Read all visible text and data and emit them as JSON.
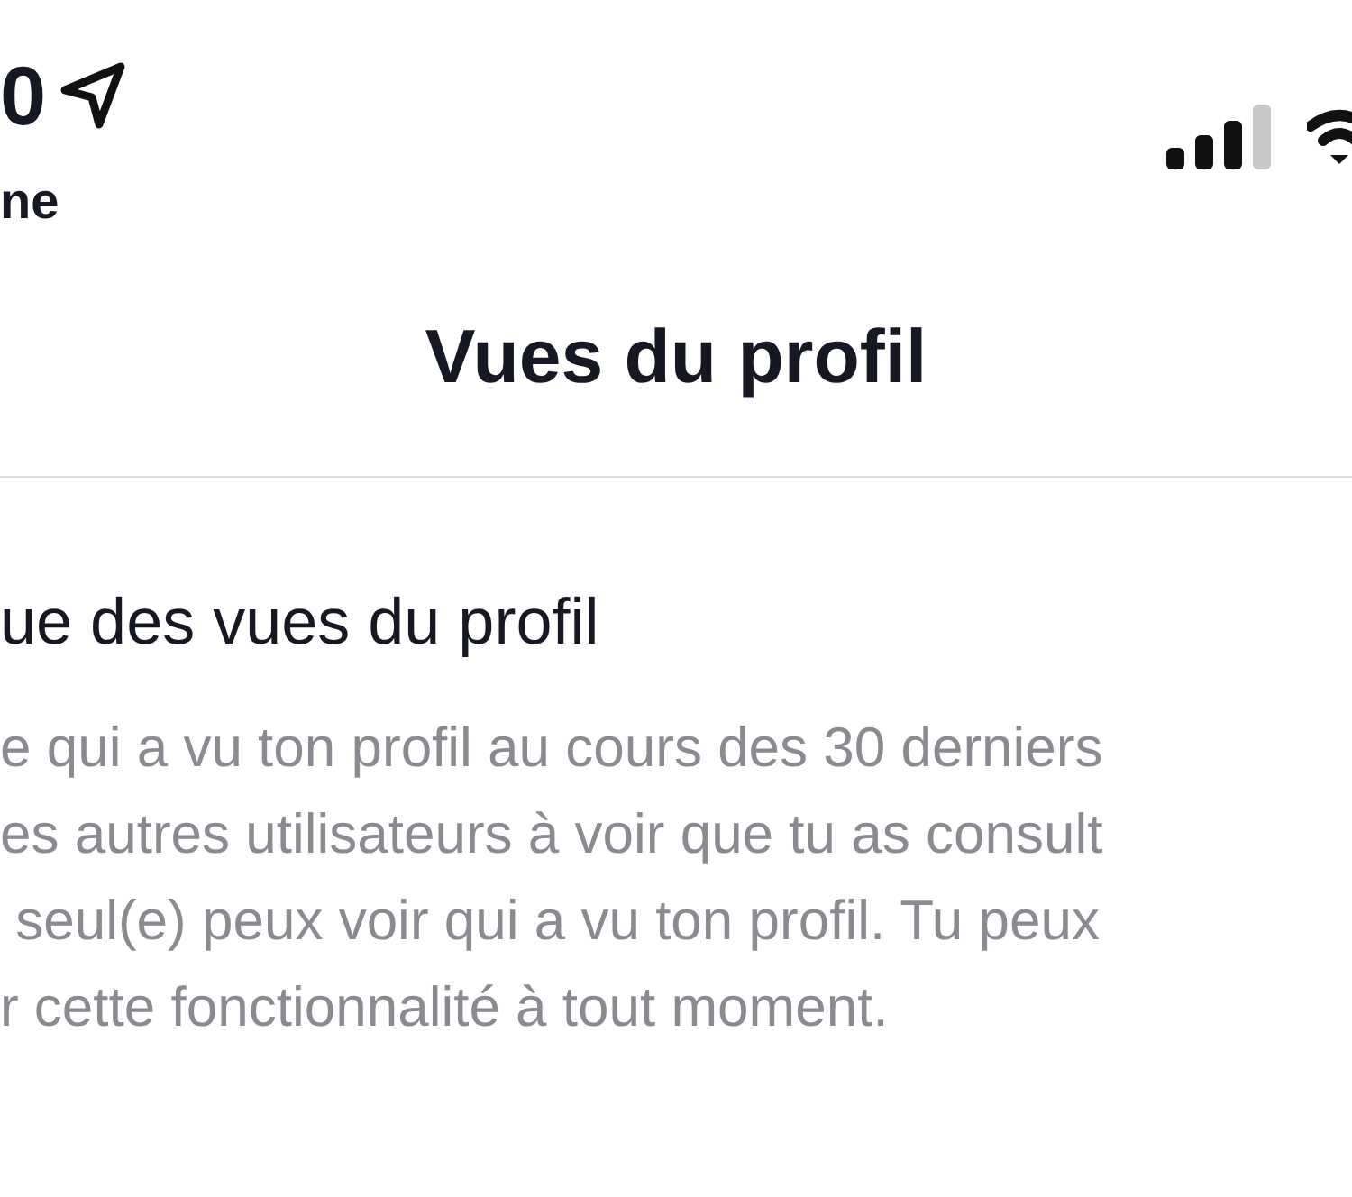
{
  "status_bar": {
    "time": "0",
    "carrier": "ne"
  },
  "header": {
    "title": "Vues du profil"
  },
  "section": {
    "heading": "ue des vues du profil",
    "lines": [
      "e qui a vu ton profil au cours des 30 derniers",
      "es autres utilisateurs à voir que tu as consult",
      " seul(e) peux voir qui a vu ton profil. Tu peux",
      "r cette fonctionnalité à tout moment."
    ]
  }
}
